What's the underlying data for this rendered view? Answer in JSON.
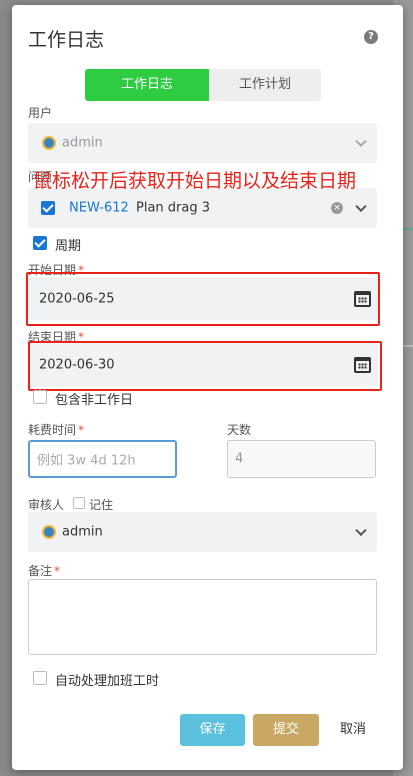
{
  "dialog": {
    "title": "工作日志",
    "help_icon": "?"
  },
  "tabs": [
    {
      "label": "工作日志",
      "active": true
    },
    {
      "label": "工作计划",
      "active": false
    }
  ],
  "user": {
    "label": "用户",
    "value": "admin"
  },
  "issue": {
    "label": "问题",
    "key": "NEW-612",
    "summary": "Plan drag 3",
    "checked": true
  },
  "annotation": "鼠标松开后获取开始日期以及结束日期",
  "period": {
    "label": "周期",
    "checked": true
  },
  "start_date": {
    "label": "开始日期",
    "required": "*",
    "value": "2020-06-25"
  },
  "end_date": {
    "label": "结束日期",
    "required": "*",
    "value": "2020-06-30"
  },
  "include_non_working": {
    "label": "包含非工作日",
    "checked": false
  },
  "time_spent": {
    "label": "耗费时间",
    "required": "*",
    "placeholder": "例如 3w 4d 12h"
  },
  "days": {
    "label": "天数",
    "value": "4"
  },
  "reviewer": {
    "label": "审核人",
    "remember_label": "记住",
    "value": "admin"
  },
  "remark": {
    "label": "备注",
    "required": "*"
  },
  "auto_overtime": {
    "label": "自动处理加班工时",
    "checked": false
  },
  "buttons": {
    "save": "保存",
    "submit": "提交",
    "cancel": "取消"
  },
  "colors": {
    "tab_active": "#2ecc40",
    "save_button": "#5bc0de",
    "submit_button": "#c8a862",
    "highlight": "#e8231a"
  }
}
